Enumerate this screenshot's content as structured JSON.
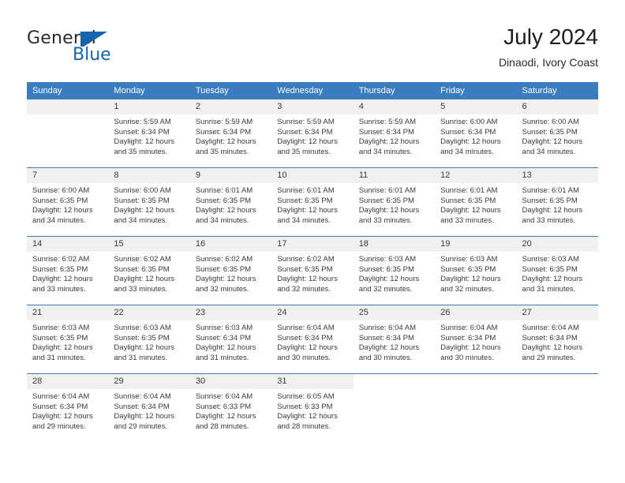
{
  "brand": {
    "name_top": "General",
    "name_bottom": "Blue",
    "flag_color": "#1565ad"
  },
  "header": {
    "title": "July 2024",
    "subtitle": "Dinaodi, Ivory Coast"
  },
  "theme": {
    "header_blue": "#3b7cbf",
    "daynum_bg": "#f0f0f0",
    "text": "#3a3a3a"
  },
  "weekdays": [
    "Sunday",
    "Monday",
    "Tuesday",
    "Wednesday",
    "Thursday",
    "Friday",
    "Saturday"
  ],
  "weeks": [
    [
      {
        "day": "",
        "lines": []
      },
      {
        "day": "1",
        "lines": [
          "Sunrise: 5:59 AM",
          "Sunset: 6:34 PM",
          "Daylight: 12 hours",
          "and 35 minutes."
        ]
      },
      {
        "day": "2",
        "lines": [
          "Sunrise: 5:59 AM",
          "Sunset: 6:34 PM",
          "Daylight: 12 hours",
          "and 35 minutes."
        ]
      },
      {
        "day": "3",
        "lines": [
          "Sunrise: 5:59 AM",
          "Sunset: 6:34 PM",
          "Daylight: 12 hours",
          "and 35 minutes."
        ]
      },
      {
        "day": "4",
        "lines": [
          "Sunrise: 5:59 AM",
          "Sunset: 6:34 PM",
          "Daylight: 12 hours",
          "and 34 minutes."
        ]
      },
      {
        "day": "5",
        "lines": [
          "Sunrise: 6:00 AM",
          "Sunset: 6:34 PM",
          "Daylight: 12 hours",
          "and 34 minutes."
        ]
      },
      {
        "day": "6",
        "lines": [
          "Sunrise: 6:00 AM",
          "Sunset: 6:35 PM",
          "Daylight: 12 hours",
          "and 34 minutes."
        ]
      }
    ],
    [
      {
        "day": "7",
        "lines": [
          "Sunrise: 6:00 AM",
          "Sunset: 6:35 PM",
          "Daylight: 12 hours",
          "and 34 minutes."
        ]
      },
      {
        "day": "8",
        "lines": [
          "Sunrise: 6:00 AM",
          "Sunset: 6:35 PM",
          "Daylight: 12 hours",
          "and 34 minutes."
        ]
      },
      {
        "day": "9",
        "lines": [
          "Sunrise: 6:01 AM",
          "Sunset: 6:35 PM",
          "Daylight: 12 hours",
          "and 34 minutes."
        ]
      },
      {
        "day": "10",
        "lines": [
          "Sunrise: 6:01 AM",
          "Sunset: 6:35 PM",
          "Daylight: 12 hours",
          "and 34 minutes."
        ]
      },
      {
        "day": "11",
        "lines": [
          "Sunrise: 6:01 AM",
          "Sunset: 6:35 PM",
          "Daylight: 12 hours",
          "and 33 minutes."
        ]
      },
      {
        "day": "12",
        "lines": [
          "Sunrise: 6:01 AM",
          "Sunset: 6:35 PM",
          "Daylight: 12 hours",
          "and 33 minutes."
        ]
      },
      {
        "day": "13",
        "lines": [
          "Sunrise: 6:01 AM",
          "Sunset: 6:35 PM",
          "Daylight: 12 hours",
          "and 33 minutes."
        ]
      }
    ],
    [
      {
        "day": "14",
        "lines": [
          "Sunrise: 6:02 AM",
          "Sunset: 6:35 PM",
          "Daylight: 12 hours",
          "and 33 minutes."
        ]
      },
      {
        "day": "15",
        "lines": [
          "Sunrise: 6:02 AM",
          "Sunset: 6:35 PM",
          "Daylight: 12 hours",
          "and 33 minutes."
        ]
      },
      {
        "day": "16",
        "lines": [
          "Sunrise: 6:02 AM",
          "Sunset: 6:35 PM",
          "Daylight: 12 hours",
          "and 32 minutes."
        ]
      },
      {
        "day": "17",
        "lines": [
          "Sunrise: 6:02 AM",
          "Sunset: 6:35 PM",
          "Daylight: 12 hours",
          "and 32 minutes."
        ]
      },
      {
        "day": "18",
        "lines": [
          "Sunrise: 6:03 AM",
          "Sunset: 6:35 PM",
          "Daylight: 12 hours",
          "and 32 minutes."
        ]
      },
      {
        "day": "19",
        "lines": [
          "Sunrise: 6:03 AM",
          "Sunset: 6:35 PM",
          "Daylight: 12 hours",
          "and 32 minutes."
        ]
      },
      {
        "day": "20",
        "lines": [
          "Sunrise: 6:03 AM",
          "Sunset: 6:35 PM",
          "Daylight: 12 hours",
          "and 31 minutes."
        ]
      }
    ],
    [
      {
        "day": "21",
        "lines": [
          "Sunrise: 6:03 AM",
          "Sunset: 6:35 PM",
          "Daylight: 12 hours",
          "and 31 minutes."
        ]
      },
      {
        "day": "22",
        "lines": [
          "Sunrise: 6:03 AM",
          "Sunset: 6:35 PM",
          "Daylight: 12 hours",
          "and 31 minutes."
        ]
      },
      {
        "day": "23",
        "lines": [
          "Sunrise: 6:03 AM",
          "Sunset: 6:34 PM",
          "Daylight: 12 hours",
          "and 31 minutes."
        ]
      },
      {
        "day": "24",
        "lines": [
          "Sunrise: 6:04 AM",
          "Sunset: 6:34 PM",
          "Daylight: 12 hours",
          "and 30 minutes."
        ]
      },
      {
        "day": "25",
        "lines": [
          "Sunrise: 6:04 AM",
          "Sunset: 6:34 PM",
          "Daylight: 12 hours",
          "and 30 minutes."
        ]
      },
      {
        "day": "26",
        "lines": [
          "Sunrise: 6:04 AM",
          "Sunset: 6:34 PM",
          "Daylight: 12 hours",
          "and 30 minutes."
        ]
      },
      {
        "day": "27",
        "lines": [
          "Sunrise: 6:04 AM",
          "Sunset: 6:34 PM",
          "Daylight: 12 hours",
          "and 29 minutes."
        ]
      }
    ],
    [
      {
        "day": "28",
        "lines": [
          "Sunrise: 6:04 AM",
          "Sunset: 6:34 PM",
          "Daylight: 12 hours",
          "and 29 minutes."
        ]
      },
      {
        "day": "29",
        "lines": [
          "Sunrise: 6:04 AM",
          "Sunset: 6:34 PM",
          "Daylight: 12 hours",
          "and 29 minutes."
        ]
      },
      {
        "day": "30",
        "lines": [
          "Sunrise: 6:04 AM",
          "Sunset: 6:33 PM",
          "Daylight: 12 hours",
          "and 28 minutes."
        ]
      },
      {
        "day": "31",
        "lines": [
          "Sunrise: 6:05 AM",
          "Sunset: 6:33 PM",
          "Daylight: 12 hours",
          "and 28 minutes."
        ]
      },
      {
        "day": "",
        "lines": []
      },
      {
        "day": "",
        "lines": []
      },
      {
        "day": "",
        "lines": []
      }
    ]
  ]
}
